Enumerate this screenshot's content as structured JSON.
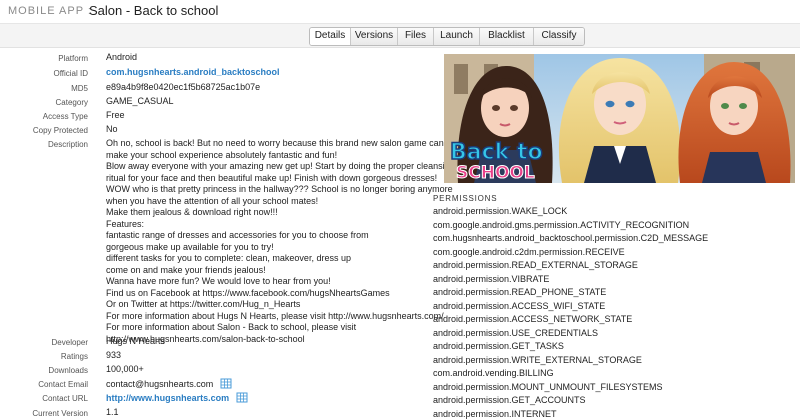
{
  "header": {
    "app_label": "MOBILE APP",
    "separator": ":",
    "title": "Salon - Back to school"
  },
  "tabs": [
    "Details",
    "Versions",
    "Files",
    "Launch",
    "Blacklist",
    "Classify"
  ],
  "details": {
    "platform": {
      "label": "Platform",
      "value": "Android"
    },
    "official_id": {
      "label": "Official ID",
      "value": "com.hugsnhearts.android_backtoschool"
    },
    "md5": {
      "label": "MD5",
      "value": "e89a4b9f8e0420ec1f5b68725ac1b07e"
    },
    "category": {
      "label": "Category",
      "value": "GAME_CASUAL"
    },
    "access_type": {
      "label": "Access Type",
      "value": "Free"
    },
    "copy_protected": {
      "label": "Copy Protected",
      "value": "No"
    },
    "description": {
      "label": "Description",
      "lines": [
        "Oh no, school is back! But no need to worry because this brand new salon game can",
        "make your school experience absolutely fantastic and fun!",
        "Blow away everyone with your amazing new get up! Start by doing the proper cleansing",
        "ritual for your face and then beautiful make up! Finish with down gorgeous dresses!",
        "WOW who is that pretty princess in the hallway??? School is no longer boring anymore",
        "when you have the attention of all your school mates!",
        "Make them jealous & download right now!!!",
        "Features:",
        "fantastic range of dresses and accessories for you to choose from",
        "gorgeous make up available for you to try!",
        "different tasks for you to complete: clean, makeover, dress up",
        "come on and make your friends jealous!",
        "Wanna have more fun? We would love to hear from you!",
        "Find us on Facebook at https://www.facebook.com/hugsNheartsGames",
        "Or on Twitter at https://twitter.com/Hug_n_Hearts",
        "For more information about Hugs N Hearts, please visit http://www.hugsnhearts.com/",
        "For more information about Salon - Back to school, please visit",
        "http://www.hugsnhearts.com/salon-back-to-school"
      ]
    },
    "developer": {
      "label": "Developer",
      "value": "Hugs N Hearts"
    },
    "ratings": {
      "label": "Ratings",
      "value": "933"
    },
    "downloads": {
      "label": "Downloads",
      "value": "100,000+"
    },
    "contact_email": {
      "label": "Contact Email",
      "value": "contact@hugsnhearts.com"
    },
    "contact_url": {
      "label": "Contact URL",
      "value": "http://www.hugsnhearts.com"
    },
    "current_version": {
      "label": "Current Version",
      "value": "1.1"
    }
  },
  "hero": {
    "text_line1": "Back to",
    "text_line2": "SCHOOL"
  },
  "permissions": {
    "title": "PERMISSIONS",
    "items": [
      "android.permission.WAKE_LOCK",
      "com.google.android.gms.permission.ACTIVITY_RECOGNITION",
      "com.hugsnhearts.android_backtoschool.permission.C2D_MESSAGE",
      "com.google.android.c2dm.permission.RECEIVE",
      "android.permission.READ_EXTERNAL_STORAGE",
      "android.permission.VIBRATE",
      "android.permission.READ_PHONE_STATE",
      "android.permission.ACCESS_WIFI_STATE",
      "android.permission.ACCESS_NETWORK_STATE",
      "android.permission.USE_CREDENTIALS",
      "android.permission.GET_TASKS",
      "android.permission.WRITE_EXTERNAL_STORAGE",
      "com.android.vending.BILLING",
      "android.permission.MOUNT_UNMOUNT_FILESYSTEMS",
      "android.permission.GET_ACCOUNTS",
      "android.permission.INTERNET"
    ]
  },
  "colors": {
    "link": "#2a7dc2",
    "hero_text": "#35c6e8",
    "hero_text_pink": "#e8408a"
  }
}
